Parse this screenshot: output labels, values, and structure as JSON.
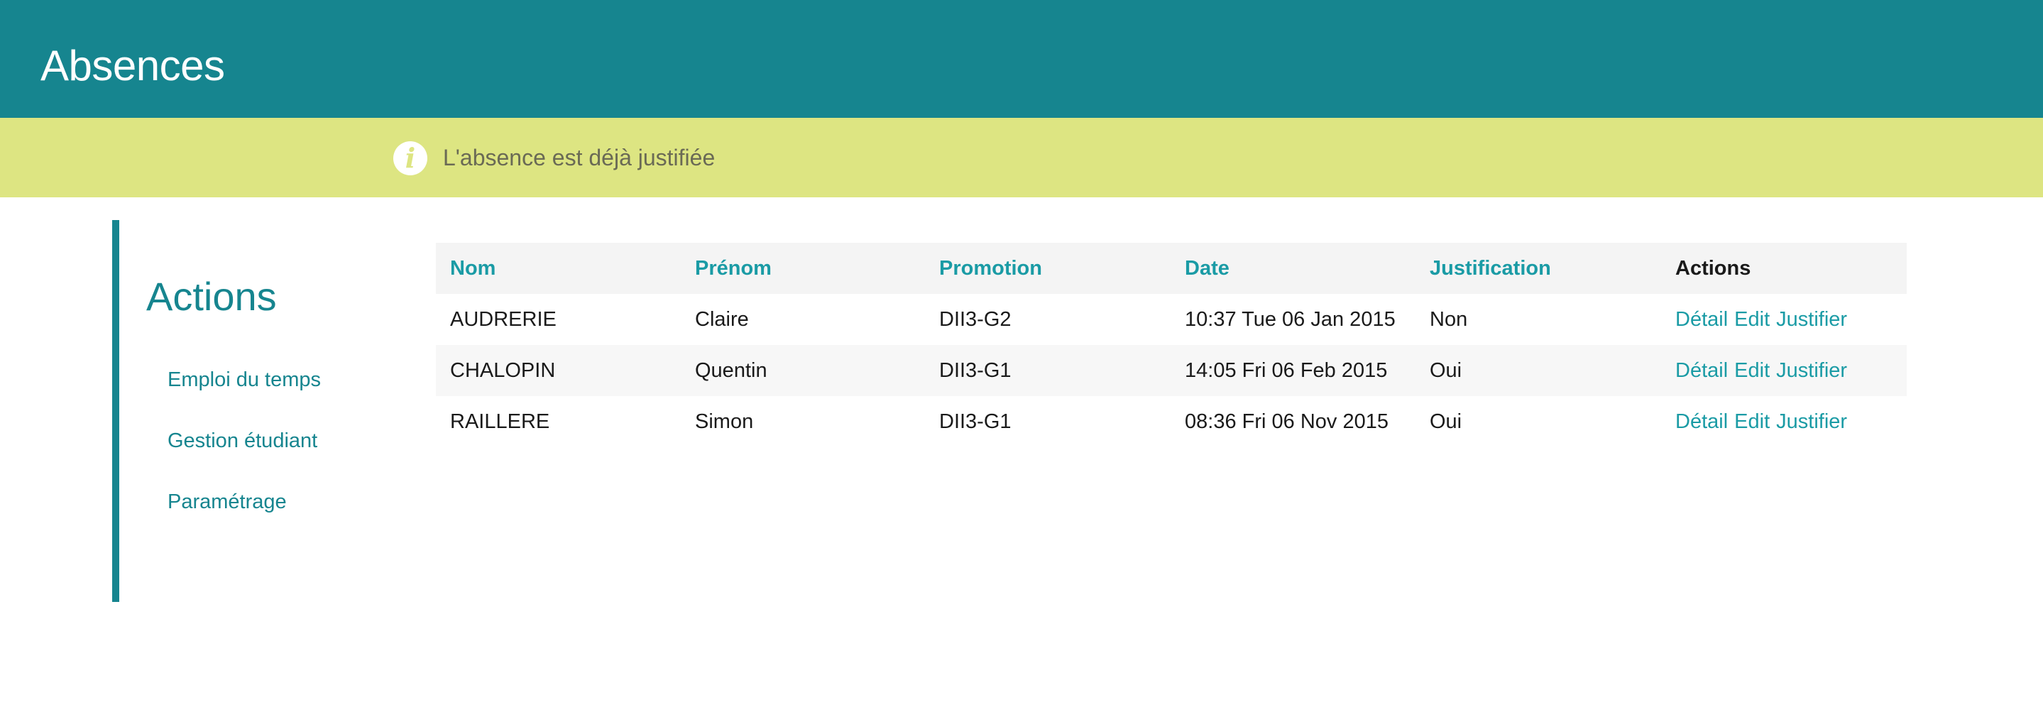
{
  "header": {
    "title": "Absences"
  },
  "alert": {
    "icon": "info-icon",
    "message": "L'absence est déjà justifiée",
    "color": "#dde582"
  },
  "sidebar": {
    "title": "Actions",
    "items": [
      {
        "label": "Emploi du temps"
      },
      {
        "label": "Gestion étudiant"
      },
      {
        "label": "Paramétrage"
      }
    ]
  },
  "table": {
    "columns": [
      "Nom",
      "Prénom",
      "Promotion",
      "Date",
      "Justification",
      "Actions"
    ],
    "rows": [
      {
        "nom": "AUDRERIE",
        "prenom": "Claire",
        "promotion": "DII3-G2",
        "date": "10:37 Tue 06 Jan 2015",
        "justification": "Non",
        "actions": [
          "Détail",
          "Edit",
          "Justifier"
        ]
      },
      {
        "nom": "CHALOPIN",
        "prenom": "Quentin",
        "promotion": "DII3-G1",
        "date": "14:05 Fri 06 Feb 2015",
        "justification": "Oui",
        "actions": [
          "Détail",
          "Edit",
          "Justifier"
        ]
      },
      {
        "nom": "RAILLERE",
        "prenom": "Simon",
        "promotion": "DII3-G1",
        "date": "08:36 Fri 06 Nov 2015",
        "justification": "Oui",
        "actions": [
          "Détail",
          "Edit",
          "Justifier"
        ]
      }
    ]
  },
  "colors": {
    "brand": "#16858f",
    "link": "#1a9ba5"
  }
}
